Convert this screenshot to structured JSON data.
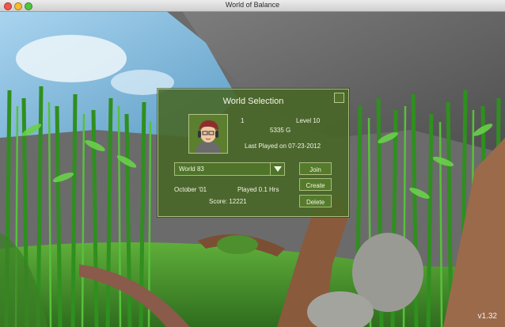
{
  "window": {
    "title": "World of Balance"
  },
  "dialog": {
    "title": "World Selection",
    "player": {
      "slot": "1",
      "level": "Level 10",
      "gold": "5335 G",
      "last_played": "Last Played on 07-23-2012"
    },
    "world_select": {
      "selected": "World 83"
    },
    "world_info": {
      "date": "October '01",
      "played": "Played 0.1 Hrs",
      "score": "Score: 12221"
    },
    "buttons": {
      "join": "Join",
      "create": "Create",
      "delete": "Delete"
    }
  },
  "version": "v1.32",
  "colors": {
    "panel": "#486724",
    "panel_border": "#a9bd7c",
    "foliage": "#3fa52a"
  }
}
